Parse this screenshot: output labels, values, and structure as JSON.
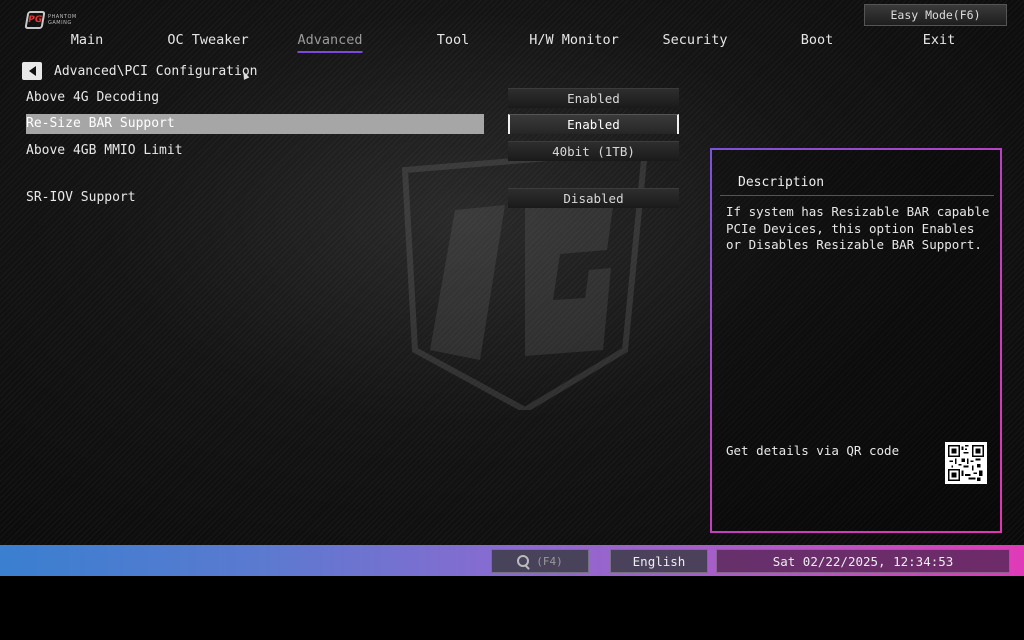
{
  "brand": {
    "line1": "PHANTOM",
    "line2": "GAMING"
  },
  "easy_mode": "Easy Mode(F6)",
  "menu": [
    {
      "label": "Main",
      "active": false
    },
    {
      "label": "OC Tweaker",
      "active": false
    },
    {
      "label": "Advanced",
      "active": true
    },
    {
      "label": "Tool",
      "active": false
    },
    {
      "label": "H/W Monitor",
      "active": false
    },
    {
      "label": "Security",
      "active": false
    },
    {
      "label": "Boot",
      "active": false
    },
    {
      "label": "Exit",
      "active": false
    }
  ],
  "breadcrumb": "Advanced\\PCI Configuration",
  "settings": [
    {
      "label": "Above 4G Decoding",
      "value": "Enabled",
      "selected": false
    },
    {
      "label": "Re-Size BAR Support",
      "value": "Enabled",
      "selected": true
    },
    {
      "label": "Above 4GB MMIO Limit",
      "value": "40bit (1TB)",
      "selected": false
    },
    {
      "label": "SR-IOV Support",
      "value": "Disabled",
      "selected": false
    }
  ],
  "description": {
    "title": "Description",
    "body": "If system has Resizable BAR capable PCIe Devices, this option Enables or Disables Resizable BAR Support.",
    "qr_label": "Get details via QR code"
  },
  "bottom": {
    "search_hint": "(F4)",
    "language": "English",
    "datetime": "Sat 02/22/2025, 12:34:53"
  },
  "colors": {
    "accent": "#7a4ad8",
    "panel_border_start": "#7a52d8",
    "panel_border_end": "#e036b4",
    "selected_row": "#a6a6a6"
  }
}
